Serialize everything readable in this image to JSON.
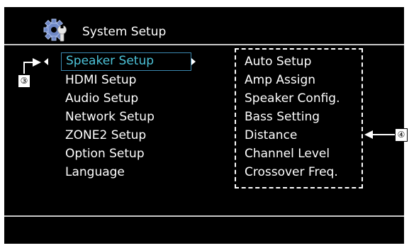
{
  "header": {
    "title": "System Setup",
    "icon": "gear-wrench-icon"
  },
  "menu": {
    "items": [
      {
        "label": "Speaker Setup",
        "selected": true
      },
      {
        "label": "HDMI Setup"
      },
      {
        "label": "Audio Setup"
      },
      {
        "label": "Network Setup"
      },
      {
        "label": "ZONE2 Setup"
      },
      {
        "label": "Option Setup"
      },
      {
        "label": "Language"
      }
    ]
  },
  "submenu": {
    "items": [
      {
        "label": "Auto Setup"
      },
      {
        "label": "Amp Assign"
      },
      {
        "label": "Speaker Config."
      },
      {
        "label": "Bass Setting"
      },
      {
        "label": "Distance"
      },
      {
        "label": "Channel Level"
      },
      {
        "label": "Crossover Freq."
      }
    ]
  },
  "callouts": {
    "cursor": "③",
    "submenu": "④"
  },
  "colors": {
    "screen_bg": "#000000",
    "selected_text": "#4dc3d9",
    "selected_border": "#3b87ae",
    "divider": "#c8c8c8"
  }
}
